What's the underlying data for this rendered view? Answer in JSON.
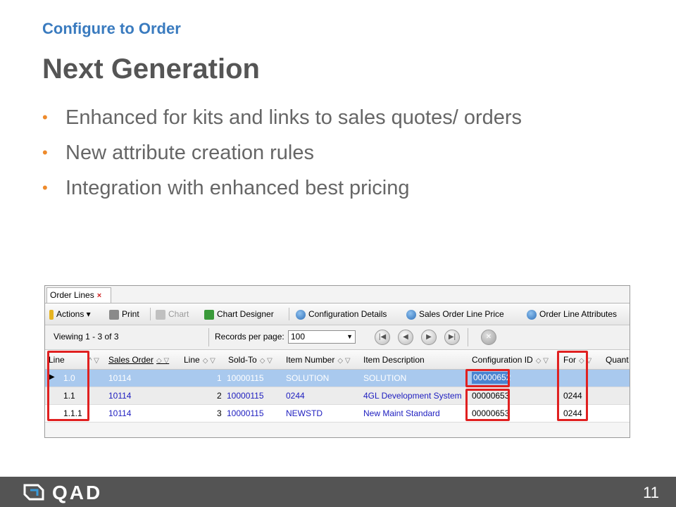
{
  "slide": {
    "subtitle": "Configure to Order",
    "title": "Next Generation",
    "bullets": [
      "Enhanced for kits and links to sales quotes/ orders",
      "New attribute creation rules",
      "Integration with enhanced best pricing"
    ],
    "bullet_glyph": "•",
    "page_number": "11",
    "colors": {
      "subtitle": "#3a7bbf",
      "title": "#555555",
      "bullet": "#ee8a2b",
      "footer": "#545454",
      "highlight_box": "#e02020"
    }
  },
  "footer": {
    "logo_text": "QAD",
    "logo_icon": "qad-logo-icon"
  },
  "screenshot": {
    "tab": {
      "label": "Order Lines",
      "close_glyph": "×"
    },
    "toolbar": {
      "actions": "Actions ▾",
      "print": "Print",
      "chart": "Chart",
      "chart_designer": "Chart Designer",
      "configuration_details": "Configuration Details",
      "sales_order_line_price": "Sales Order Line Price",
      "order_line_attributes": "Order Line Attributes"
    },
    "pager": {
      "viewing": "Viewing 1 - 3 of 3",
      "records_per_page_label": "Records per page:",
      "records_per_page_value": "100",
      "first_glyph": "|◀",
      "prev_glyph": "◀",
      "next_glyph": "▶",
      "last_glyph": "▶|",
      "close_glyph": "✕"
    },
    "columns": [
      "Line",
      "Sales Order",
      "Line",
      "Sold-To",
      "Item Number",
      "Item Description",
      "Configuration ID",
      "For",
      "Quant"
    ],
    "rows": [
      {
        "line": "1.0",
        "sales_order": "10114",
        "line_no": "1",
        "sold_to": "10000115",
        "item_number": "SOLUTION",
        "item_description": "SOLUTION",
        "configuration_id": "00000652",
        "for": ""
      },
      {
        "line": "1.1",
        "sales_order": "10114",
        "line_no": "2",
        "sold_to": "10000115",
        "item_number": "0244",
        "item_description": "4GL Development System",
        "configuration_id": "00000653",
        "for": "0244"
      },
      {
        "line": "1.1.1",
        "sales_order": "10114",
        "line_no": "3",
        "sold_to": "10000115",
        "item_number": "NEWSTD",
        "item_description": "New Maint Standard",
        "configuration_id": "00000653",
        "for": "0244"
      }
    ]
  }
}
